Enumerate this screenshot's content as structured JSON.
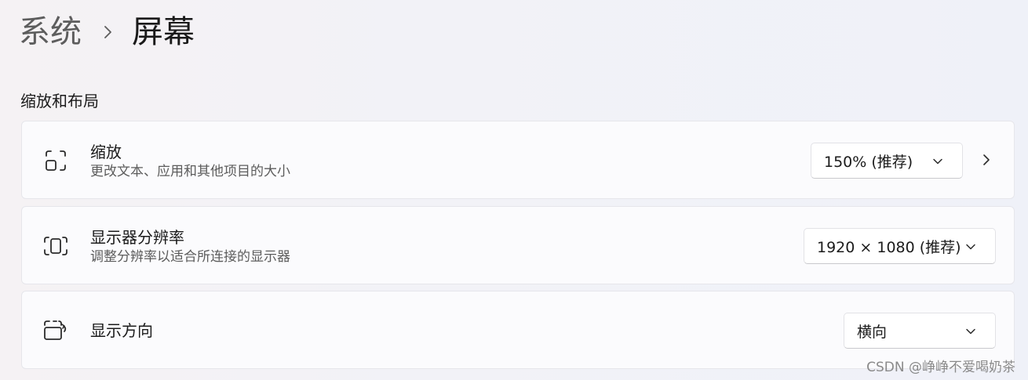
{
  "breadcrumb": {
    "parent": "系统",
    "current": "屏幕"
  },
  "section": {
    "title": "缩放和布局"
  },
  "rows": [
    {
      "icon": "scale-icon",
      "title": "缩放",
      "description": "更改文本、应用和其他项目的大小",
      "value": "150% (推荐)",
      "has_nav_chevron": true
    },
    {
      "icon": "resolution-icon",
      "title": "显示器分辨率",
      "description": "调整分辨率以适合所连接的显示器",
      "value": "1920 × 1080 (推荐)"
    },
    {
      "icon": "orientation-icon",
      "title": "显示方向",
      "value": "横向"
    }
  ],
  "watermark": "CSDN @峥峥不爱喝奶茶",
  "colors": {
    "card_background": "#fbfbfd",
    "page_background": "#f2f2f7",
    "secondary_text": "#5c5c5c"
  }
}
